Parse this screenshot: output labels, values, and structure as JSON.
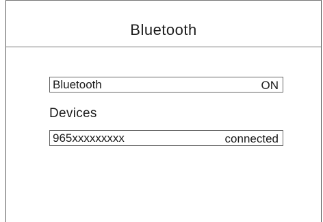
{
  "header": {
    "title": "Bluetooth"
  },
  "bluetooth_setting": {
    "label": "Bluetooth",
    "value": "ON"
  },
  "devices": {
    "heading": "Devices",
    "items": [
      {
        "name": "965xxxxxxxxx",
        "status": "connected"
      }
    ]
  }
}
